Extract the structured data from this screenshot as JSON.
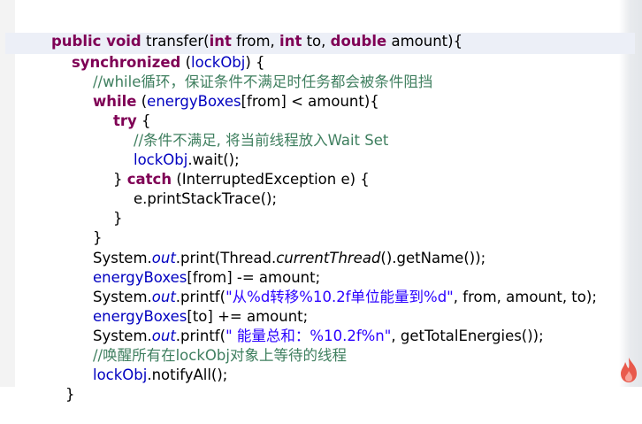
{
  "code": {
    "l1": {
      "a": "public void",
      "b": " transfer(",
      "c": "int",
      "d": " from, ",
      "e": "int",
      "f": " to, ",
      "g": "double",
      "h": " amount){"
    },
    "l2": {
      "a": "synchronized",
      "b": " (",
      "c": "lockObj",
      "d": ") {"
    },
    "l3": {
      "a": "//while循环，保证条件不满足时任务都会被条件阻挡"
    },
    "l4": {
      "a": "while",
      "b": " (",
      "c": "energyBoxes",
      "d": "[from] < amount){"
    },
    "l5": {
      "a": "try",
      "b": " {"
    },
    "l6": {
      "a": "//条件不满足, 将当前线程放入Wait Set"
    },
    "l7": {
      "a": "lockObj",
      "b": ".wait();"
    },
    "l8": {
      "a": "} ",
      "b": "catch",
      "c": " (InterruptedException e) {"
    },
    "l9": {
      "a": "e.printStackTrace();"
    },
    "l10": {
      "a": "}"
    },
    "l11": {
      "a": "}"
    },
    "l12": {
      "a": "System.",
      "b": "out",
      "c": ".print(Thread.",
      "d": "currentThread",
      "e": "().getName());"
    },
    "l13": {
      "a": "energyBoxes",
      "b": "[from] -= amount;"
    },
    "l14": {
      "a": "System.",
      "b": "out",
      "c": ".printf(",
      "d": "\"从%d转移%10.2f单位能量到%d\"",
      "e": ", from, amount, to);"
    },
    "l15": {
      "a": "energyBoxes",
      "b": "[to] += amount;"
    },
    "l16": {
      "a": "System.",
      "b": "out",
      "c": ".printf(",
      "d": "\" 能量总和：%10.2f%n\"",
      "e": ", getTotalEnergies());"
    },
    "l17": {
      "a": "//唤醒所有在lockObj对象上等待的线程"
    },
    "l18": {
      "a": "lockObj",
      "b": ".notifyAll();"
    },
    "l19": {
      "a": "}"
    }
  },
  "colors": {
    "keyword": "#7f0055",
    "comment": "#3f7f5f",
    "field": "#0000c0",
    "string": "#2a00ff",
    "current_line": "#eceff7"
  },
  "icons": {
    "watermark": "flame-logo-icon"
  }
}
